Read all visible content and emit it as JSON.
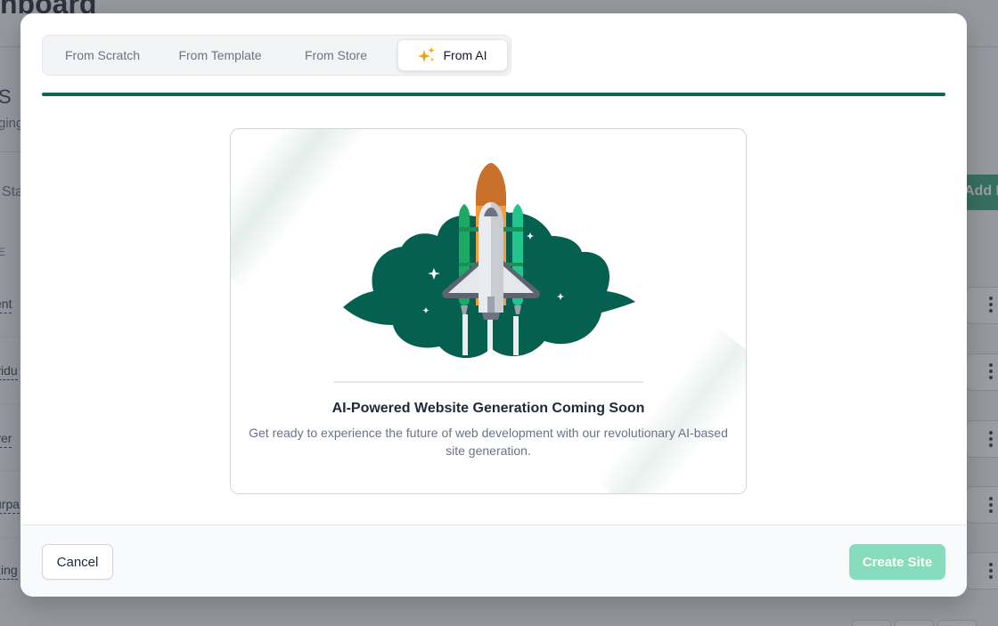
{
  "background": {
    "page_title": "nboard",
    "side_heading": "S",
    "side_subtitle": "ging",
    "status_filter": "Sta",
    "add_button": "Add N",
    "column_header": "E",
    "rows": [
      "ent",
      "vidu",
      "ver",
      "urpa",
      "zing"
    ]
  },
  "tabs": [
    {
      "label": "From Scratch",
      "active": false
    },
    {
      "label": "From Template",
      "active": false
    },
    {
      "label": "From Store",
      "active": false
    },
    {
      "label": "From AI",
      "active": true,
      "icon": "sparkle-icon"
    }
  ],
  "progress": {
    "fraction": 1.0,
    "color": "#0e6652"
  },
  "card": {
    "illustration": "rocket-launch-illustration",
    "title": "AI-Powered Website Generation Coming Soon",
    "description": "Get ready to experience the future of web development with our revolutionary AI-based site generation."
  },
  "footer": {
    "cancel_label": "Cancel",
    "create_label": "Create Site",
    "create_enabled": false
  },
  "colors": {
    "brand_green": "#0e6652",
    "cloud_green": "#06604f",
    "create_button": "#86dcbc",
    "sparkle": "#f59e0b"
  }
}
